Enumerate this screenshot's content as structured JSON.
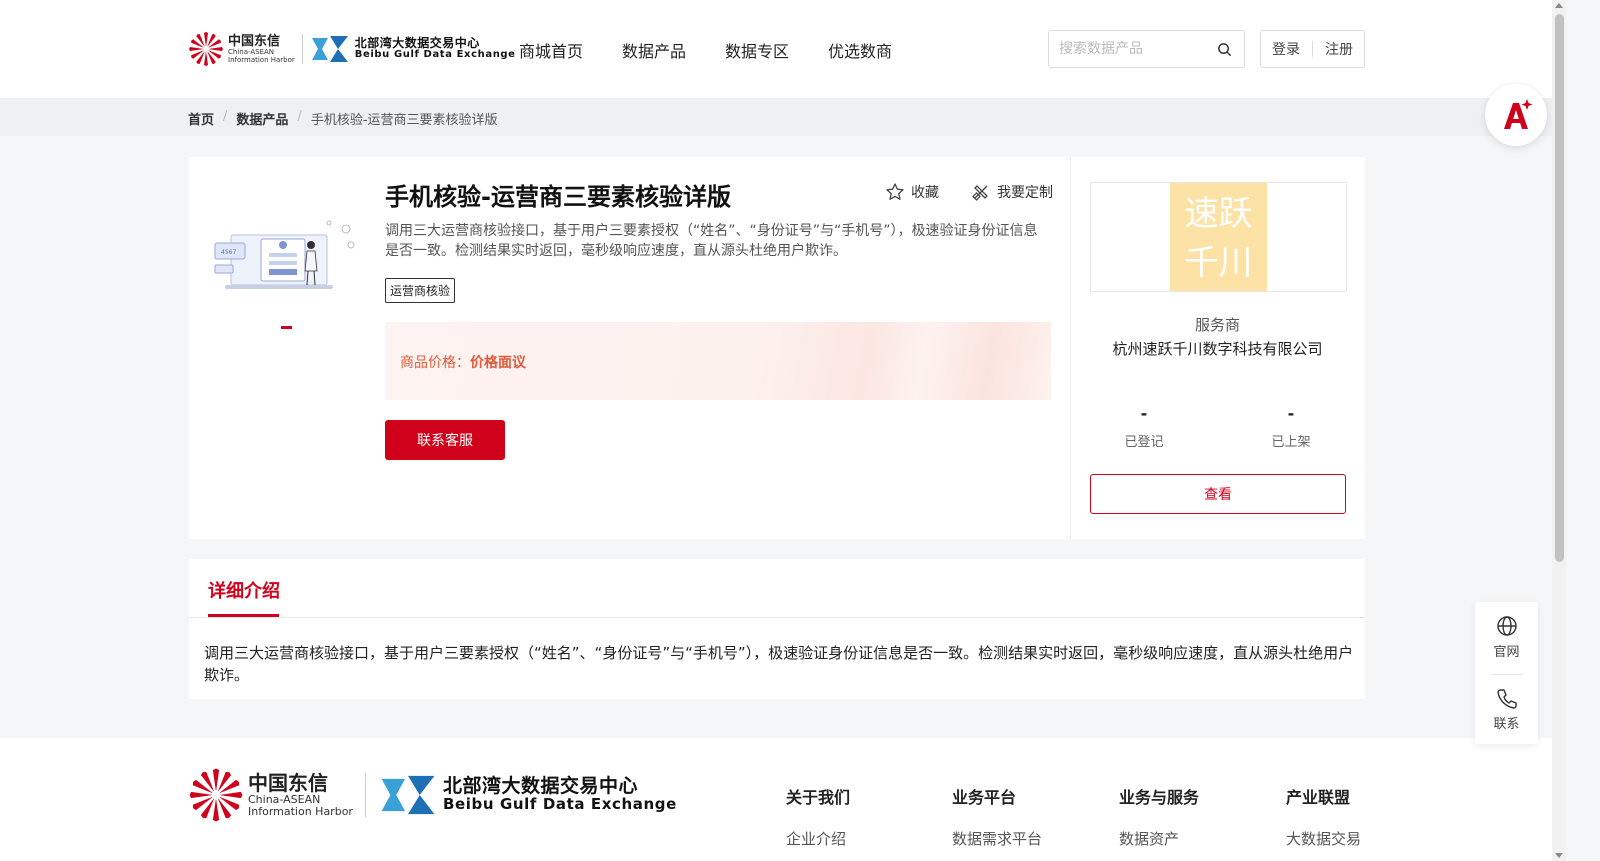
{
  "header": {
    "logo_cn": "中国东信",
    "logo_en1": "China-ASEAN",
    "logo_en2": "Information Harbor",
    "logo2_cn": "北部湾大数据交易中心",
    "logo2_en": "Beibu Gulf Data Exchange",
    "nav": [
      "商城首页",
      "数据产品",
      "数据专区",
      "优选数商"
    ],
    "search_placeholder": "搜索数据产品",
    "login": "登录",
    "register": "注册"
  },
  "breadcrumb": [
    "首页",
    "数据产品",
    "手机核验-运营商三要素核验详版"
  ],
  "product": {
    "title": "手机核验-运营商三要素核验详版",
    "favorite": "收藏",
    "customize": "我要定制",
    "description": "调用三大运营商核验接口，基于用户三要素授权（“姓名”、“身份证号”与“手机号”），极速验证身份证信息是否一致。检测结果实时返回，毫秒级响应速度，直从源头杜绝用户欺诈。",
    "tag": "运营商核验",
    "price_label": "商品价格：",
    "price_value": "价格面议",
    "contact_button": "联系客服",
    "image_badge": "4567"
  },
  "vendor": {
    "logo_line1": "速跃",
    "logo_line2": "千川",
    "role": "服务商",
    "name": "杭州速跃千川数字科技有限公司",
    "stats": [
      {
        "value": "-",
        "label": "已登记"
      },
      {
        "value": "-",
        "label": "已上架"
      }
    ],
    "view_button": "查看"
  },
  "detail": {
    "tab": "详细介绍",
    "text": "调用三大运营商核验接口，基于用户三要素授权（“姓名”、“身份证号”与“手机号”），极速验证身份证信息是否一致。检测结果实时返回，毫秒级响应速度，直从源头杜绝用户欺诈。"
  },
  "footer": {
    "columns": [
      {
        "heading": "关于我们",
        "item": "企业介绍"
      },
      {
        "heading": "业务平台",
        "item": "数据需求平台"
      },
      {
        "heading": "业务与服务",
        "item": "数据资产"
      },
      {
        "heading": "产业联盟",
        "item": "大数据交易"
      }
    ]
  },
  "side_float": {
    "official": "官网",
    "contact": "联系"
  },
  "colors": {
    "brand_red": "#d0021b",
    "price_orange": "#e05a3a",
    "vendor_logo_bg": "#fde2a6"
  }
}
